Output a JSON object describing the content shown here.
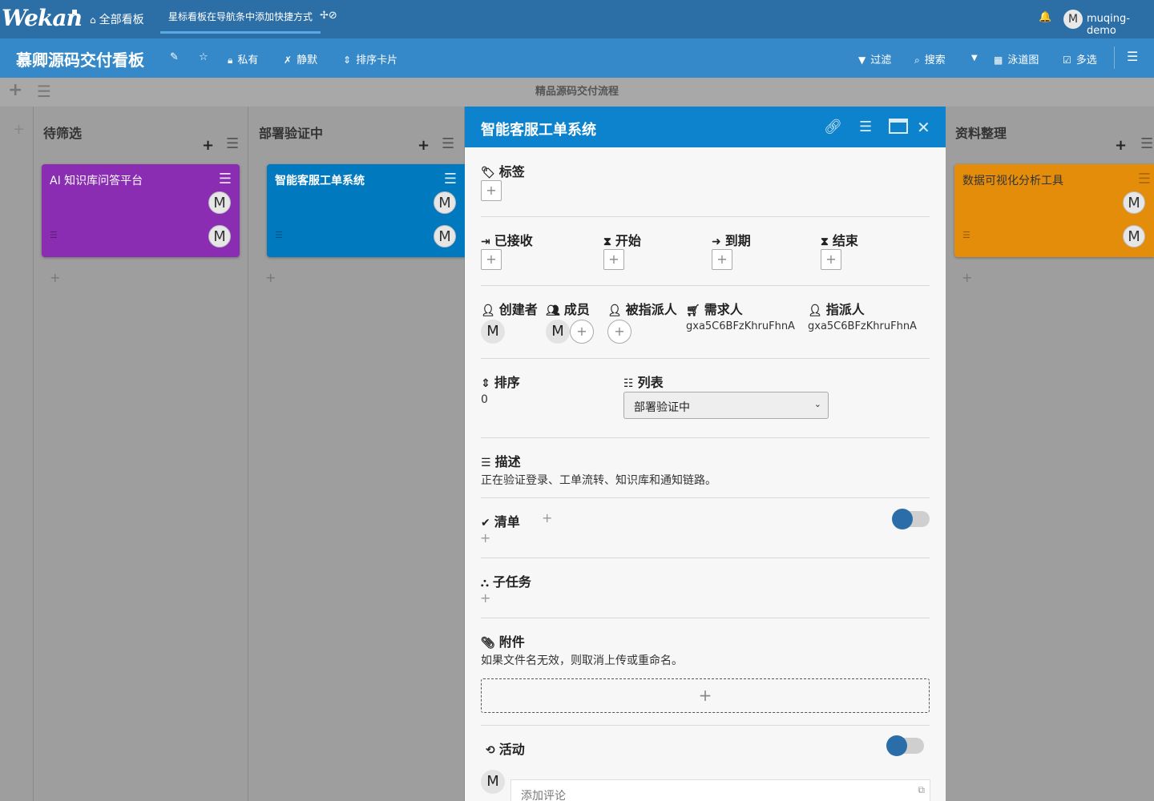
{
  "topbar": {
    "logo": "Wekan",
    "home_label": "全部看板",
    "starred_tab": "星标看板在导航条中添加快捷方式",
    "starred_actions": "✢⊘",
    "user_initial": "M",
    "user_name": "muqing-demo"
  },
  "board": {
    "title": "慕卿源码交付看板",
    "private_label": "私有",
    "mute_label": "静默",
    "sort_label": "排序卡片",
    "filter_label": "过滤",
    "search_label": "搜索",
    "swimlane_view_label": "泳道图",
    "multiselect_label": "多选"
  },
  "swimlane": {
    "title": "精品源码交付流程"
  },
  "lists": [
    {
      "title": "待筛选",
      "card_title": "AI 知识库问答平台",
      "card_color": "#8a2db2"
    },
    {
      "title": "部署验证中",
      "card_title": "智能客服工单系统",
      "card_color": "#0079bf"
    },
    {
      "title": "资料整理",
      "card_title": "数据可视化分析工具",
      "card_color": "#e48d0b"
    }
  ],
  "avatar_initial": "M",
  "detail": {
    "title": "智能客服工单系统",
    "labels_title": "标签",
    "received_title": "已接收",
    "start_title": "开始",
    "due_title": "到期",
    "end_title": "结束",
    "creator_title": "创建者",
    "members_title": "成员",
    "assignee_title": "被指派人",
    "requester_title": "需求人",
    "requester_value": "gxa5C6BFzKhruFhnA",
    "assigner_title": "指派人",
    "assigner_value": "gxa5C6BFzKhruFhnA",
    "sort_title": "排序",
    "sort_value": "0",
    "list_title": "列表",
    "list_value": "部署验证中",
    "description_title": "描述",
    "description_text": "正在验证登录、工单流转、知识库和通知链路。",
    "checklist_title": "清单",
    "subtasks_title": "子任务",
    "attachments_title": "附件",
    "attachments_hint": "如果文件名无效，则取消上传或重命名。",
    "activity_title": "活动",
    "comment_placeholder": "添加评论"
  }
}
